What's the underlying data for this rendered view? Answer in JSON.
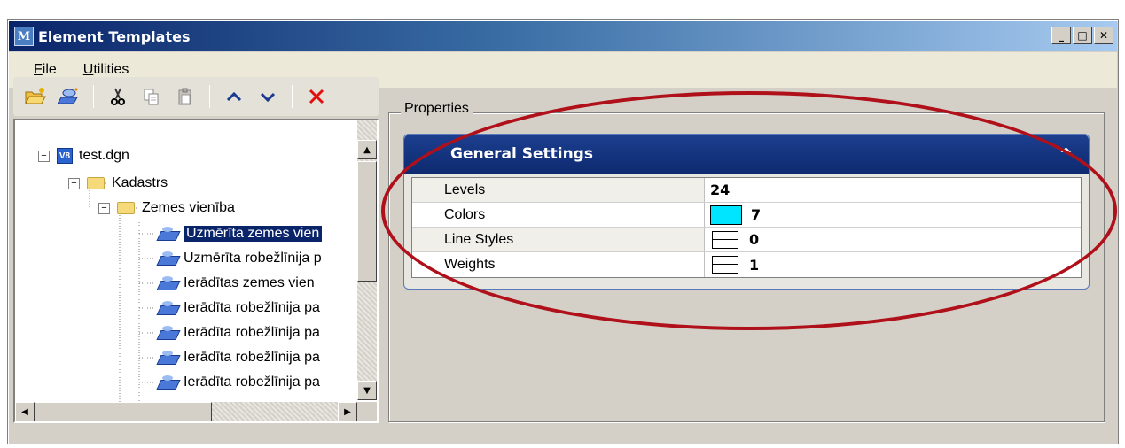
{
  "window": {
    "title": "Element Templates",
    "controls": {
      "minimize": "_",
      "maximize": "□",
      "close": "✕"
    }
  },
  "menu": {
    "file": {
      "first": "F",
      "rest": "ile"
    },
    "utilities": {
      "first": "U",
      "rest": "tilities"
    }
  },
  "toolbar": {
    "icons": [
      "open-folder-icon",
      "new-template-icon",
      "cut-icon",
      "copy-icon",
      "paste-icon",
      "move-up-icon",
      "move-down-icon",
      "delete-icon"
    ]
  },
  "tree": {
    "root": "test.dgn",
    "root_badge": "V8",
    "folder": "Kadastrs",
    "subfolder": "Zemes vienība",
    "items": [
      "Uzmērīta zemes vien",
      "Uzmērīta robežlīnija p",
      "Ierādītas zemes vien",
      "Ierādīta robežlīnija pa",
      "Ierādīta robežlīnija pa",
      "Ierādīta robežlīnija pa",
      "Ierādīta robežlīnija pa"
    ],
    "selected_index": 0
  },
  "properties": {
    "legend": "Properties",
    "section_title": "General Settings",
    "rows": [
      {
        "name": "Levels",
        "value": "24"
      },
      {
        "name": "Colors",
        "value": "7",
        "swatch_color": "#00e5ff"
      },
      {
        "name": "Line Styles",
        "value": "0"
      },
      {
        "name": "Weights",
        "value": "1"
      }
    ]
  },
  "colors": {
    "title_bar_start": "#0a246a",
    "selection": "#0a246a",
    "annotation_ellipse": "#b0101a"
  }
}
